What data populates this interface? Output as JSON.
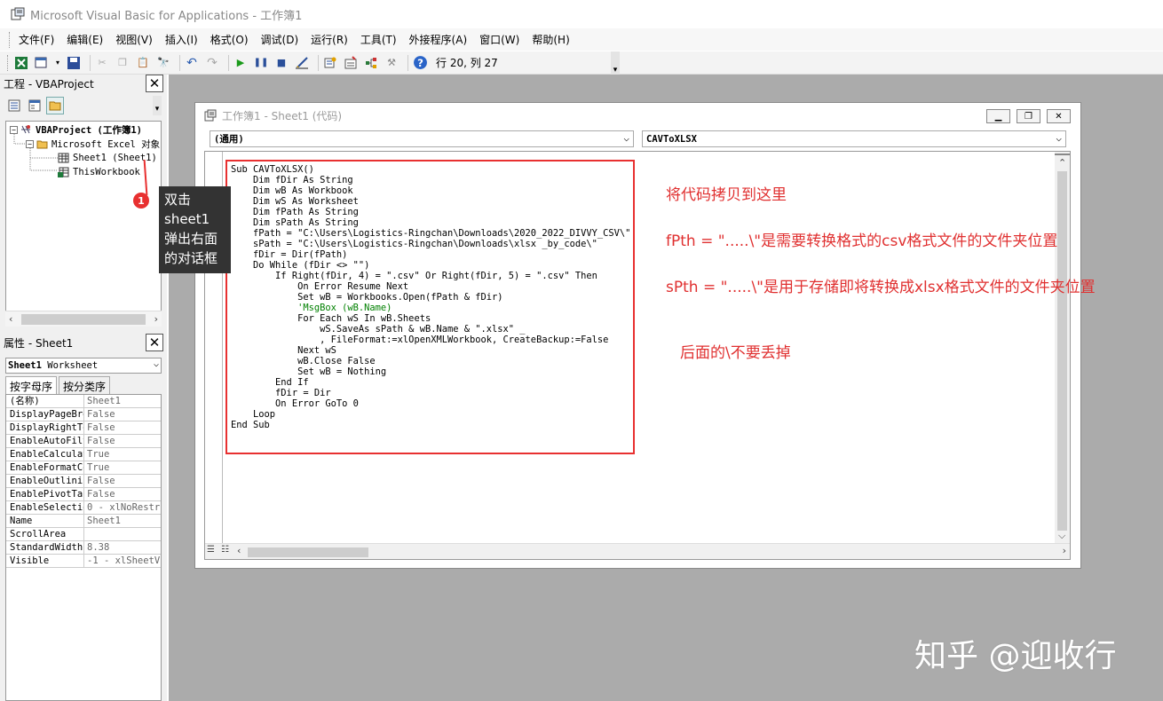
{
  "app": {
    "title": "Microsoft Visual Basic for Applications - 工作簿1"
  },
  "menu": [
    "文件(F)",
    "编辑(E)",
    "视图(V)",
    "插入(I)",
    "格式(O)",
    "调试(D)",
    "运行(R)",
    "工具(T)",
    "外接程序(A)",
    "窗口(W)",
    "帮助(H)"
  ],
  "toolbar": {
    "position": "行 20, 列 27"
  },
  "project_pane": {
    "title": "工程 - VBAProject",
    "close": "✕",
    "tree": [
      {
        "label": "VBAProject (工作簿1)",
        "bold": true
      },
      {
        "label": "Microsoft Excel 对象"
      },
      {
        "label": "Sheet1 (Sheet1)"
      },
      {
        "label": "ThisWorkbook"
      }
    ]
  },
  "properties_pane": {
    "title": "属性 - Sheet1",
    "close": "✕",
    "object_select": "Sheet1 Worksheet",
    "object_select_bold": "Sheet1",
    "object_select_rest": " Worksheet",
    "tabs": [
      "按字母序",
      "按分类序"
    ],
    "rows": [
      {
        "name": "(名称)",
        "value": "Sheet1"
      },
      {
        "name": "DisplayPageBre",
        "value": "False"
      },
      {
        "name": "DisplayRightTo",
        "value": "False"
      },
      {
        "name": "EnableAutoFilt",
        "value": "False"
      },
      {
        "name": "EnableCalculat",
        "value": "True"
      },
      {
        "name": "EnableFormatCo",
        "value": "True"
      },
      {
        "name": "EnableOutlinin",
        "value": "False"
      },
      {
        "name": "EnablePivotTab",
        "value": "False"
      },
      {
        "name": "EnableSelectio",
        "value": "0 - xlNoRestr"
      },
      {
        "name": "Name",
        "value": "Sheet1"
      },
      {
        "name": "ScrollArea",
        "value": ""
      },
      {
        "name": "StandardWidth",
        "value": "8.38"
      },
      {
        "name": "Visible",
        "value": "-1 - xlSheetV"
      }
    ]
  },
  "code_window": {
    "title": "工作簿1 - Sheet1 (代码)",
    "object_combo": "(通用)",
    "proc_combo": "CAVToXLSX",
    "code_lines": [
      {
        "text": "Sub CAVToXLSX()"
      },
      {
        "text": "    Dim fDir As String"
      },
      {
        "text": "    Dim wB As Workbook"
      },
      {
        "text": "    Dim wS As Worksheet"
      },
      {
        "text": "    Dim fPath As String"
      },
      {
        "text": "    Dim sPath As String"
      },
      {
        "text": "    fPath = \"C:\\Users\\Logistics-Ringchan\\Downloads\\2020_2022_DIVVY_CSV\\\""
      },
      {
        "text": "    sPath = \"C:\\Users\\Logistics-Ringchan\\Downloads\\xlsx _by_code\\\""
      },
      {
        "text": "    fDir = Dir(fPath)"
      },
      {
        "text": "    Do While (fDir <> \"\")"
      },
      {
        "text": "        If Right(fDir, 4) = \".csv\" Or Right(fDir, 5) = \".csv\" Then"
      },
      {
        "text": "            On Error Resume Next"
      },
      {
        "text": "            Set wB = Workbooks.Open(fPath & fDir)"
      },
      {
        "text": "            'MsgBox (wB.Name)",
        "comment": true
      },
      {
        "text": "            For Each wS In wB.Sheets"
      },
      {
        "text": "                wS.SaveAs sPath & wB.Name & \".xlsx\" _"
      },
      {
        "text": "                , FileFormat:=xlOpenXMLWorkbook, CreateBackup:=False"
      },
      {
        "text": "            Next wS"
      },
      {
        "text": "            wB.Close False"
      },
      {
        "text": "            Set wB = Nothing"
      },
      {
        "text": "        End If"
      },
      {
        "text": "        fDir = Dir"
      },
      {
        "text": "        On Error GoTo 0"
      },
      {
        "text": "    Loop"
      },
      {
        "text": "End Sub"
      }
    ]
  },
  "annotations": {
    "callout_badge": "1",
    "callout_text": [
      "双击",
      "sheet1",
      "弹出右面",
      "的对话框"
    ],
    "note1": "将代码拷贝到这里",
    "note2": "fPth = \".....\\\"是需要转换格式的csv格式文件的文件夹位置",
    "note3": "sPth = \".....\\\"是用于存储即将转换成xlsx格式文件的文件夹位置",
    "note4": "后面的\\不要丢掉",
    "color": "#e03030"
  },
  "watermark": "知乎 @迎收行"
}
